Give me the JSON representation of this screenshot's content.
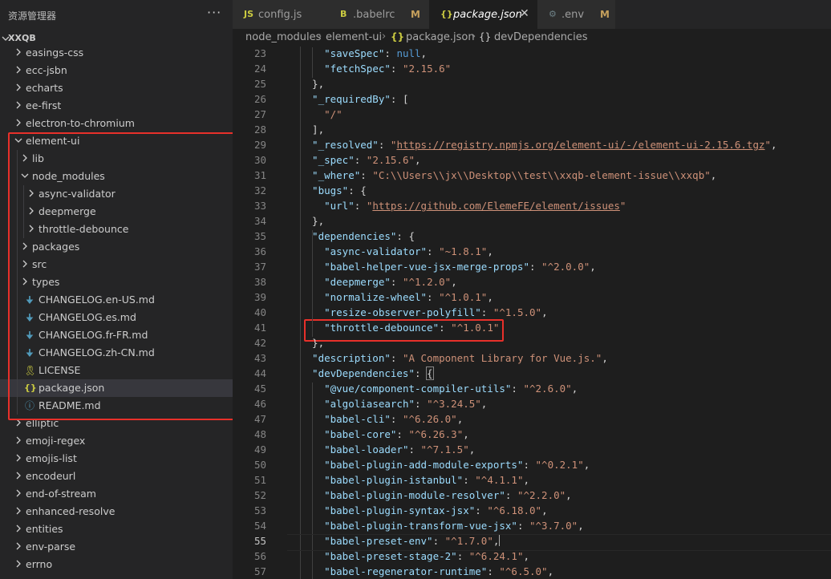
{
  "sidebar": {
    "title": "资源管理器",
    "more_label": "···",
    "root_label": "XXQB",
    "items": [
      {
        "label": "easings-css",
        "indent": 0,
        "type": "folder",
        "open": false
      },
      {
        "label": "ecc-jsbn",
        "indent": 0,
        "type": "folder",
        "open": false
      },
      {
        "label": "echarts",
        "indent": 0,
        "type": "folder",
        "open": false
      },
      {
        "label": "ee-first",
        "indent": 0,
        "type": "folder",
        "open": false
      },
      {
        "label": "electron-to-chromium",
        "indent": 0,
        "type": "folder",
        "open": false
      },
      {
        "label": "element-ui",
        "indent": 0,
        "type": "folder",
        "open": true
      },
      {
        "label": "lib",
        "indent": 1,
        "type": "folder",
        "open": false
      },
      {
        "label": "node_modules",
        "indent": 1,
        "type": "folder",
        "open": true
      },
      {
        "label": "async-validator",
        "indent": 2,
        "type": "folder",
        "open": false
      },
      {
        "label": "deepmerge",
        "indent": 2,
        "type": "folder",
        "open": false
      },
      {
        "label": "throttle-debounce",
        "indent": 2,
        "type": "folder",
        "open": false
      },
      {
        "label": "packages",
        "indent": 1,
        "type": "folder",
        "open": false
      },
      {
        "label": "src",
        "indent": 1,
        "type": "folder",
        "open": false
      },
      {
        "label": "types",
        "indent": 1,
        "type": "folder",
        "open": false
      },
      {
        "label": "CHANGELOG.en-US.md",
        "indent": 1,
        "type": "md"
      },
      {
        "label": "CHANGELOG.es.md",
        "indent": 1,
        "type": "md"
      },
      {
        "label": "CHANGELOG.fr-FR.md",
        "indent": 1,
        "type": "md"
      },
      {
        "label": "CHANGELOG.zh-CN.md",
        "indent": 1,
        "type": "md"
      },
      {
        "label": "LICENSE",
        "indent": 1,
        "type": "license"
      },
      {
        "label": "package.json",
        "indent": 1,
        "type": "json",
        "selected": true
      },
      {
        "label": "README.md",
        "indent": 1,
        "type": "readme"
      },
      {
        "label": "elliptic",
        "indent": 0,
        "type": "folder",
        "open": false
      },
      {
        "label": "emoji-regex",
        "indent": 0,
        "type": "folder",
        "open": false
      },
      {
        "label": "emojis-list",
        "indent": 0,
        "type": "folder",
        "open": false
      },
      {
        "label": "encodeurl",
        "indent": 0,
        "type": "folder",
        "open": false
      },
      {
        "label": "end-of-stream",
        "indent": 0,
        "type": "folder",
        "open": false
      },
      {
        "label": "enhanced-resolve",
        "indent": 0,
        "type": "folder",
        "open": false
      },
      {
        "label": "entities",
        "indent": 0,
        "type": "folder",
        "open": false
      },
      {
        "label": "env-parse",
        "indent": 0,
        "type": "folder",
        "open": false
      },
      {
        "label": "errno",
        "indent": 0,
        "type": "folder",
        "open": false
      }
    ],
    "icon_glyphs": {
      "md": "🠋",
      "license": "🎗",
      "json": "{}",
      "readme": "ⓘ"
    },
    "icon_colors": {
      "md": "#519aba",
      "license": "#cbcb41",
      "json": "#cbcb41",
      "readme": "#519aba"
    }
  },
  "tabs": [
    {
      "icon": "JS",
      "icon_color": "#cbcb41",
      "label": "config.js",
      "modified": "",
      "active": false
    },
    {
      "icon": "B",
      "icon_color": "#cbcb41",
      "label": ".babelrc",
      "modified": "M",
      "active": false
    },
    {
      "icon": "{}",
      "icon_color": "#cbcb41",
      "label": "package.json",
      "modified": "",
      "active": true,
      "close": "✕"
    },
    {
      "icon": "⚙",
      "icon_color": "#6d8086",
      "label": ".env",
      "modified": "M",
      "active": false
    }
  ],
  "breadcrumb": {
    "parts": [
      "node_modules",
      "element-ui",
      "package.json",
      "devDependencies"
    ],
    "separator": "›",
    "json_icon": "{}",
    "obj_icon": "{}"
  },
  "editor": {
    "current_line": 55,
    "lines": [
      {
        "n": 23,
        "indent": 4,
        "tokens": [
          [
            "k",
            "\"saveSpec\""
          ],
          [
            "p",
            ": "
          ],
          [
            "n",
            "null"
          ],
          [
            "p",
            ","
          ]
        ]
      },
      {
        "n": 24,
        "indent": 4,
        "tokens": [
          [
            "k",
            "\"fetchSpec\""
          ],
          [
            "p",
            ": "
          ],
          [
            "s",
            "\"2.15.6\""
          ]
        ]
      },
      {
        "n": 25,
        "indent": 2,
        "tokens": [
          [
            "p",
            "},"
          ]
        ]
      },
      {
        "n": 26,
        "indent": 2,
        "tokens": [
          [
            "k",
            "\"_requiredBy\""
          ],
          [
            "p",
            ": ["
          ]
        ]
      },
      {
        "n": 27,
        "indent": 4,
        "tokens": [
          [
            "s",
            "\"/\""
          ]
        ]
      },
      {
        "n": 28,
        "indent": 2,
        "tokens": [
          [
            "p",
            "],"
          ]
        ]
      },
      {
        "n": 29,
        "indent": 2,
        "tokens": [
          [
            "k",
            "\"_resolved\""
          ],
          [
            "p",
            ": "
          ],
          [
            "s",
            "\""
          ],
          [
            "u",
            "https://registry.npmjs.org/element-ui/-/element-ui-2.15.6.tgz"
          ],
          [
            "s",
            "\""
          ],
          [
            "p",
            ","
          ]
        ]
      },
      {
        "n": 30,
        "indent": 2,
        "tokens": [
          [
            "k",
            "\"_spec\""
          ],
          [
            "p",
            ": "
          ],
          [
            "s",
            "\"2.15.6\""
          ],
          [
            "p",
            ","
          ]
        ]
      },
      {
        "n": 31,
        "indent": 2,
        "tokens": [
          [
            "k",
            "\"_where\""
          ],
          [
            "p",
            ": "
          ],
          [
            "s",
            "\"C:\\\\Users\\\\jx\\\\Desktop\\\\test\\\\xxqb-element-issue\\\\xxqb\""
          ],
          [
            "p",
            ","
          ]
        ]
      },
      {
        "n": 32,
        "indent": 2,
        "tokens": [
          [
            "k",
            "\"bugs\""
          ],
          [
            "p",
            ": {"
          ]
        ]
      },
      {
        "n": 33,
        "indent": 4,
        "tokens": [
          [
            "k",
            "\"url\""
          ],
          [
            "p",
            ": "
          ],
          [
            "s",
            "\""
          ],
          [
            "u",
            "https://github.com/ElemeFE/element/issues"
          ],
          [
            "s",
            "\""
          ]
        ]
      },
      {
        "n": 34,
        "indent": 2,
        "tokens": [
          [
            "p",
            "},"
          ]
        ]
      },
      {
        "n": 35,
        "indent": 2,
        "tokens": [
          [
            "k",
            "\"dependencies\""
          ],
          [
            "p",
            ": {"
          ]
        ]
      },
      {
        "n": 36,
        "indent": 4,
        "tokens": [
          [
            "k",
            "\"async-validator\""
          ],
          [
            "p",
            ": "
          ],
          [
            "s",
            "\"~1.8.1\""
          ],
          [
            "p",
            ","
          ]
        ]
      },
      {
        "n": 37,
        "indent": 4,
        "tokens": [
          [
            "k",
            "\"babel-helper-vue-jsx-merge-props\""
          ],
          [
            "p",
            ": "
          ],
          [
            "s",
            "\"^2.0.0\""
          ],
          [
            "p",
            ","
          ]
        ]
      },
      {
        "n": 38,
        "indent": 4,
        "tokens": [
          [
            "k",
            "\"deepmerge\""
          ],
          [
            "p",
            ": "
          ],
          [
            "s",
            "\"^1.2.0\""
          ],
          [
            "p",
            ","
          ]
        ]
      },
      {
        "n": 39,
        "indent": 4,
        "tokens": [
          [
            "k",
            "\"normalize-wheel\""
          ],
          [
            "p",
            ": "
          ],
          [
            "s",
            "\"^1.0.1\""
          ],
          [
            "p",
            ","
          ]
        ]
      },
      {
        "n": 40,
        "indent": 4,
        "tokens": [
          [
            "k",
            "\"resize-observer-polyfill\""
          ],
          [
            "p",
            ": "
          ],
          [
            "s",
            "\"^1.5.0\""
          ],
          [
            "p",
            ","
          ]
        ]
      },
      {
        "n": 41,
        "indent": 4,
        "tokens": [
          [
            "k",
            "\"throttle-debounce\""
          ],
          [
            "p",
            ": "
          ],
          [
            "s",
            "\"^1.0.1\""
          ]
        ]
      },
      {
        "n": 42,
        "indent": 2,
        "tokens": [
          [
            "p",
            "},"
          ]
        ]
      },
      {
        "n": 43,
        "indent": 2,
        "tokens": [
          [
            "k",
            "\"description\""
          ],
          [
            "p",
            ": "
          ],
          [
            "s",
            "\"A Component Library for Vue.js.\""
          ],
          [
            "p",
            ","
          ]
        ]
      },
      {
        "n": 44,
        "indent": 2,
        "tokens": [
          [
            "k",
            "\"devDependencies\""
          ],
          [
            "p",
            ": "
          ],
          [
            "b",
            "{"
          ]
        ]
      },
      {
        "n": 45,
        "indent": 4,
        "tokens": [
          [
            "k",
            "\"@vue/component-compiler-utils\""
          ],
          [
            "p",
            ": "
          ],
          [
            "s",
            "\"^2.6.0\""
          ],
          [
            "p",
            ","
          ]
        ]
      },
      {
        "n": 46,
        "indent": 4,
        "tokens": [
          [
            "k",
            "\"algoliasearch\""
          ],
          [
            "p",
            ": "
          ],
          [
            "s",
            "\"^3.24.5\""
          ],
          [
            "p",
            ","
          ]
        ]
      },
      {
        "n": 47,
        "indent": 4,
        "tokens": [
          [
            "k",
            "\"babel-cli\""
          ],
          [
            "p",
            ": "
          ],
          [
            "s",
            "\"^6.26.0\""
          ],
          [
            "p",
            ","
          ]
        ]
      },
      {
        "n": 48,
        "indent": 4,
        "tokens": [
          [
            "k",
            "\"babel-core\""
          ],
          [
            "p",
            ": "
          ],
          [
            "s",
            "\"^6.26.3\""
          ],
          [
            "p",
            ","
          ]
        ]
      },
      {
        "n": 49,
        "indent": 4,
        "tokens": [
          [
            "k",
            "\"babel-loader\""
          ],
          [
            "p",
            ": "
          ],
          [
            "s",
            "\"^7.1.5\""
          ],
          [
            "p",
            ","
          ]
        ]
      },
      {
        "n": 50,
        "indent": 4,
        "tokens": [
          [
            "k",
            "\"babel-plugin-add-module-exports\""
          ],
          [
            "p",
            ": "
          ],
          [
            "s",
            "\"^0.2.1\""
          ],
          [
            "p",
            ","
          ]
        ]
      },
      {
        "n": 51,
        "indent": 4,
        "tokens": [
          [
            "k",
            "\"babel-plugin-istanbul\""
          ],
          [
            "p",
            ": "
          ],
          [
            "s",
            "\"^4.1.1\""
          ],
          [
            "p",
            ","
          ]
        ]
      },
      {
        "n": 52,
        "indent": 4,
        "tokens": [
          [
            "k",
            "\"babel-plugin-module-resolver\""
          ],
          [
            "p",
            ": "
          ],
          [
            "s",
            "\"^2.2.0\""
          ],
          [
            "p",
            ","
          ]
        ]
      },
      {
        "n": 53,
        "indent": 4,
        "tokens": [
          [
            "k",
            "\"babel-plugin-syntax-jsx\""
          ],
          [
            "p",
            ": "
          ],
          [
            "s",
            "\"^6.18.0\""
          ],
          [
            "p",
            ","
          ]
        ]
      },
      {
        "n": 54,
        "indent": 4,
        "tokens": [
          [
            "k",
            "\"babel-plugin-transform-vue-jsx\""
          ],
          [
            "p",
            ": "
          ],
          [
            "s",
            "\"^3.7.0\""
          ],
          [
            "p",
            ","
          ]
        ]
      },
      {
        "n": 55,
        "indent": 4,
        "tokens": [
          [
            "k",
            "\"babel-preset-env\""
          ],
          [
            "p",
            ": "
          ],
          [
            "s",
            "\"^1.7.0\""
          ],
          [
            "p",
            ","
          ],
          [
            "c",
            ""
          ]
        ]
      },
      {
        "n": 56,
        "indent": 4,
        "tokens": [
          [
            "k",
            "\"babel-preset-stage-2\""
          ],
          [
            "p",
            ": "
          ],
          [
            "s",
            "\"^6.24.1\""
          ],
          [
            "p",
            ","
          ]
        ]
      },
      {
        "n": 57,
        "indent": 4,
        "tokens": [
          [
            "k",
            "\"babel-regenerator-runtime\""
          ],
          [
            "p",
            ": "
          ],
          [
            "s",
            "\"^6.5.0\""
          ],
          [
            "p",
            ","
          ]
        ]
      }
    ]
  },
  "colors": {
    "highlight_box": "#e8302a",
    "selection": "#37373d"
  }
}
